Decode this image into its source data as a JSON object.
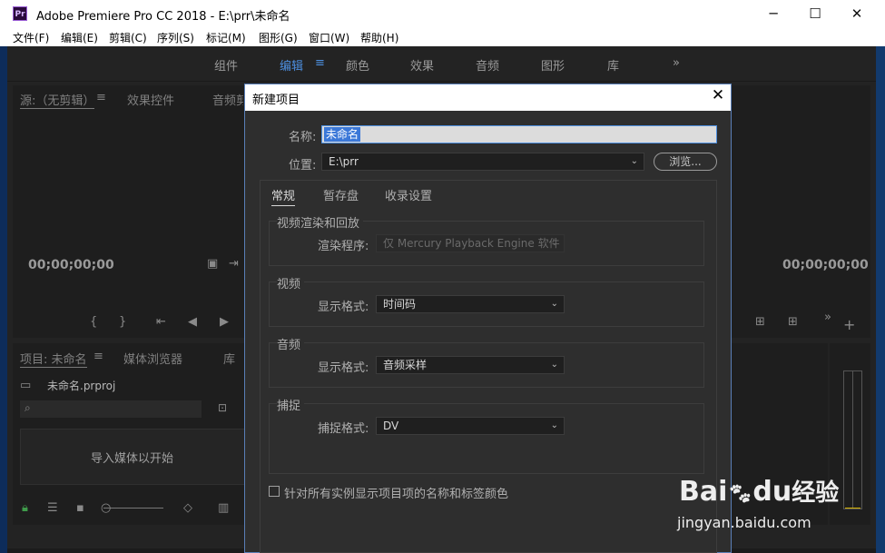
{
  "window": {
    "title": "Adobe Premiere Pro CC 2018 - E:\\prr\\未命名",
    "app_icon_text": "Pr",
    "minimize": "─",
    "maximize": "☐",
    "close": "✕"
  },
  "menubar": {
    "items": [
      "文件(F)",
      "编辑(E)",
      "剪辑(C)",
      "序列(S)",
      "标记(M)",
      "图形(G)",
      "窗口(W)",
      "帮助(H)"
    ]
  },
  "workspaces": {
    "tabs": [
      "组件",
      "编辑",
      "颜色",
      "效果",
      "音频",
      "图形",
      "库"
    ],
    "active": "编辑",
    "more": "»",
    "menu_glyph": "≡"
  },
  "source_panel": {
    "tabs": [
      "源:（无剪辑）",
      "效果控件",
      "音频剪"
    ],
    "timecode": "00;00;00;00"
  },
  "program_panel": {
    "timecode": "00;00;00;00"
  },
  "project_panel": {
    "tabs": [
      "项目: 未命名",
      "媒体浏览器",
      "库"
    ],
    "file_name": "未命名.prproj",
    "import_hint": "导入媒体以开始"
  },
  "dialog": {
    "title": "新建项目",
    "close": "✕",
    "name_label": "名称:",
    "name_value": "未命名",
    "location_label": "位置:",
    "location_value": "E:\\prr",
    "browse_button": "浏览...",
    "tabs": [
      "常规",
      "暂存盘",
      "收录设置"
    ],
    "active_tab": "常规",
    "sections": {
      "render": {
        "title": "视频渲染和回放",
        "label": "渲染程序:",
        "value": "仅 Mercury Playback Engine 软件"
      },
      "video": {
        "title": "视频",
        "label": "显示格式:",
        "value": "时间码"
      },
      "audio": {
        "title": "音频",
        "label": "显示格式:",
        "value": "音频采样"
      },
      "capture": {
        "title": "捕捉",
        "label": "捕捉格式:",
        "value": "DV"
      }
    },
    "checkbox_label": "针对所有实例显示项目项的名称和标签颜色",
    "checkbox_checked": false
  },
  "watermark": {
    "brand": "Bai",
    "brand_tail": "du",
    "suffix": "经验",
    "url": "jingyan.baidu.com"
  },
  "colors": {
    "active_tab": "#4d8fe0",
    "selection": "#3b78d8",
    "dialog_border": "#5a7fb8"
  }
}
